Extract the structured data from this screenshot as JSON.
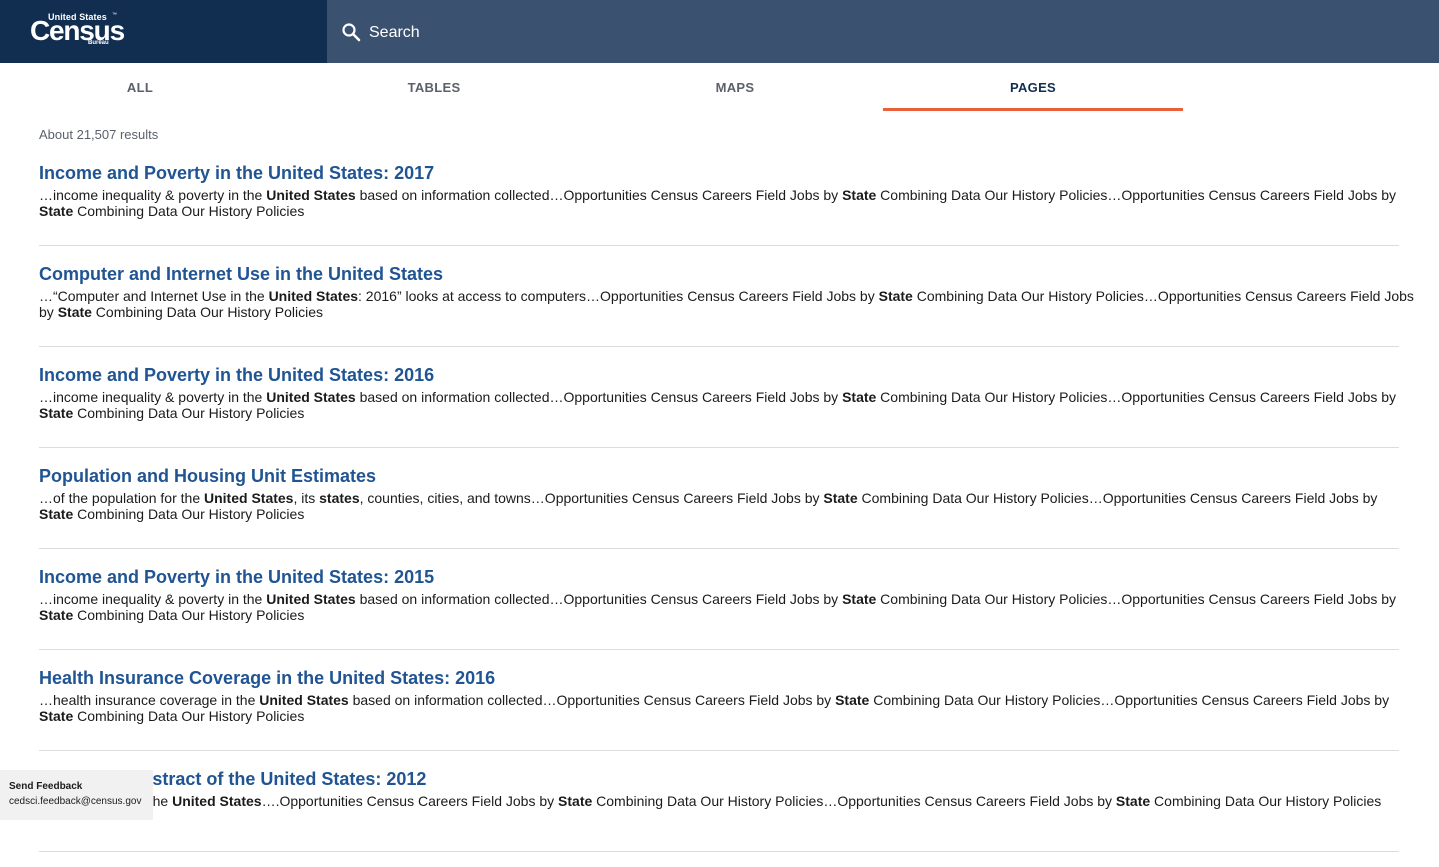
{
  "header": {
    "logo": {
      "line1": "United States",
      "tm": "™",
      "main": "Census",
      "line3": "Bureau"
    },
    "search": {
      "placeholder": "Search",
      "value": ""
    }
  },
  "tabs": [
    {
      "label": "ALL",
      "active": false
    },
    {
      "label": "TABLES",
      "active": false
    },
    {
      "label": "MAPS",
      "active": false
    },
    {
      "label": "PAGES",
      "active": true
    }
  ],
  "results_count": "About 21,507 results",
  "results": [
    {
      "title": "Income and Poverty in the United States: 2017",
      "snippet": [
        {
          "t": "…income inequality & poverty in the "
        },
        {
          "t": "United States",
          "b": true
        },
        {
          "t": " based on information collected…Opportunities Census Careers Field Jobs by "
        },
        {
          "t": "State",
          "b": true
        },
        {
          "t": " Combining Data Our History Policies…Opportunities Census Careers Field Jobs by "
        },
        {
          "t": "State",
          "b": true
        },
        {
          "t": " Combining Data Our History Policies"
        }
      ]
    },
    {
      "title": "Computer and Internet Use in the United States",
      "snippet": [
        {
          "t": "…“Computer and Internet Use in the "
        },
        {
          "t": "United States",
          "b": true
        },
        {
          "t": ": 2016” looks at access to computers…Opportunities Census Careers Field Jobs by "
        },
        {
          "t": "State",
          "b": true
        },
        {
          "t": " Combining Data Our History Policies…Opportunities Census Careers Field Jobs by "
        },
        {
          "t": "State",
          "b": true
        },
        {
          "t": " Combining Data Our History Policies"
        }
      ]
    },
    {
      "title": "Income and Poverty in the United States: 2016",
      "snippet": [
        {
          "t": "…income inequality & poverty in the "
        },
        {
          "t": "United States",
          "b": true
        },
        {
          "t": " based on information collected…Opportunities Census Careers Field Jobs by "
        },
        {
          "t": "State",
          "b": true
        },
        {
          "t": " Combining Data Our History Policies…Opportunities Census Careers Field Jobs by "
        },
        {
          "t": "State",
          "b": true
        },
        {
          "t": " Combining Data Our History Policies"
        }
      ]
    },
    {
      "title": "Population and Housing Unit Estimates",
      "snippet": [
        {
          "t": "…of the population for the "
        },
        {
          "t": "United States",
          "b": true
        },
        {
          "t": ", its "
        },
        {
          "t": "states",
          "b": true
        },
        {
          "t": ", counties, cities, and towns…Opportunities Census Careers Field Jobs by "
        },
        {
          "t": "State",
          "b": true
        },
        {
          "t": " Combining Data Our History Policies…Opportunities Census Careers Field Jobs by "
        },
        {
          "t": "State",
          "b": true
        },
        {
          "t": " Combining Data Our History Policies"
        }
      ]
    },
    {
      "title": "Income and Poverty in the United States: 2015",
      "snippet": [
        {
          "t": "…income inequality & poverty in the "
        },
        {
          "t": "United States",
          "b": true
        },
        {
          "t": " based on information collected…Opportunities Census Careers Field Jobs by "
        },
        {
          "t": "State",
          "b": true
        },
        {
          "t": " Combining Data Our History Policies…Opportunities Census Careers Field Jobs by "
        },
        {
          "t": "State",
          "b": true
        },
        {
          "t": " Combining Data Our History Policies"
        }
      ]
    },
    {
      "title": "Health Insurance Coverage in the United States: 2016",
      "snippet": [
        {
          "t": "…health insurance coverage in the "
        },
        {
          "t": "United States",
          "b": true
        },
        {
          "t": " based on information collected…Opportunities Census Careers Field Jobs by "
        },
        {
          "t": "State",
          "b": true
        },
        {
          "t": " Combining Data Our History Policies…Opportunities Census Careers Field Jobs by "
        },
        {
          "t": "State",
          "b": true
        },
        {
          "t": " Combining Data Our History Policies"
        }
      ]
    },
    {
      "title": "Statistical Abstract of the United States: 2012",
      "snippet": [
        {
          "t": "…organization of the "
        },
        {
          "t": "United States",
          "b": true
        },
        {
          "t": "….Opportunities Census Careers Field Jobs by "
        },
        {
          "t": "State",
          "b": true
        },
        {
          "t": " Combining Data Our History Policies…Opportunities Census Careers Field Jobs by "
        },
        {
          "t": "State",
          "b": true
        },
        {
          "t": " Combining Data Our History Policies"
        }
      ]
    }
  ],
  "feedback": {
    "title": "Send Feedback",
    "email": "cedsci.feedback@census.gov"
  },
  "colors": {
    "header_dark": "#112e51",
    "search_bar": "#3b5170",
    "link": "#205493",
    "tab_underline": "#e8613a"
  }
}
